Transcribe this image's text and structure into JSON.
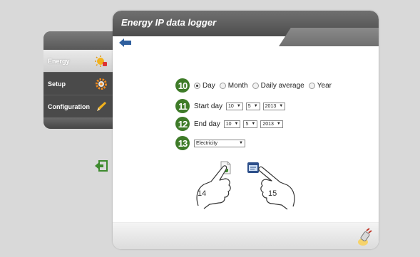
{
  "window": {
    "title": "Energy IP data logger"
  },
  "sidebar": {
    "items": [
      {
        "label": "Energy",
        "icon": "energy-icon"
      },
      {
        "label": "Setup",
        "icon": "gear-icon"
      },
      {
        "label": "Configuration",
        "icon": "pencil-icon"
      }
    ]
  },
  "form": {
    "steps": [
      "10",
      "11",
      "12",
      "13"
    ],
    "period_options": [
      "Day",
      "Month",
      "Daily average",
      "Year"
    ],
    "period_selected": "Day",
    "start_label": "Start day",
    "start": {
      "day": "10",
      "month": "5",
      "year": "2013"
    },
    "end_label": "End day",
    "end": {
      "day": "10",
      "month": "5",
      "year": "2013"
    },
    "meter_selected": "Electricity"
  },
  "callouts": {
    "export": "14",
    "display": "15"
  },
  "colors": {
    "accent": "#3e7b28",
    "header": "#5c5c5c",
    "back_arrow": "#2f5f9e"
  }
}
